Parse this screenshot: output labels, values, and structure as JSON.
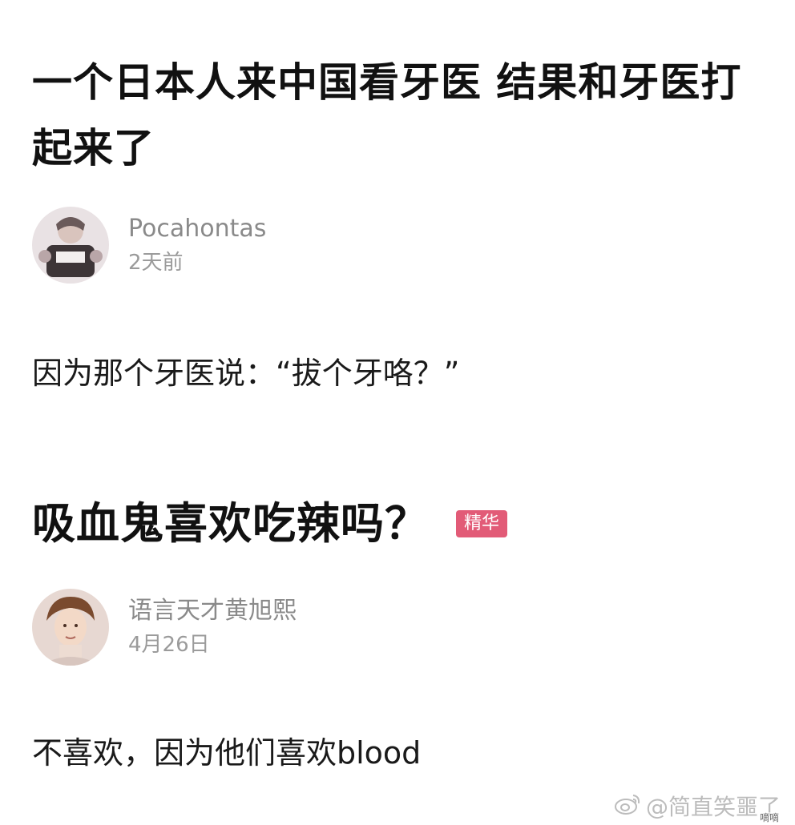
{
  "post1": {
    "title": "一个日本人来中国看牙医 结果和牙医打起来了",
    "author": {
      "name": "Pocahontas",
      "time": "2天前",
      "avatar_icon": "avatar-photo-icon"
    },
    "body": "因为那个牙医说：“拔个牙咯？”"
  },
  "post2": {
    "title": "吸血鬼喜欢吃辣吗？",
    "badge": "精华",
    "badge_color": "#e25b77",
    "author": {
      "name": "语言天才黄旭熙",
      "time": "4月26日",
      "avatar_icon": "avatar-photo-icon"
    },
    "body": "不喜欢，因为他们喜欢blood"
  },
  "watermark": {
    "text": "@简直笑噩了",
    "icon": "weibo-icon",
    "site_mark": "嘀嘀"
  }
}
